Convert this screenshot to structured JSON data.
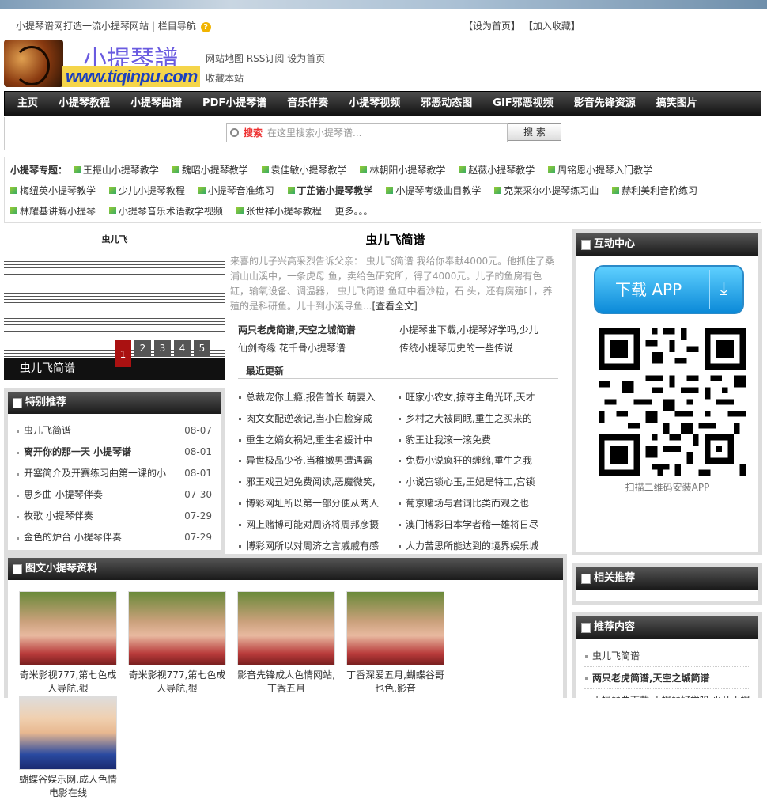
{
  "topbar": {
    "left": "小提琴谱网打造一流小提琴网站",
    "sep": "栏目导航",
    "home": "【设为首页】",
    "fav": "【加入收藏】"
  },
  "logo": {
    "cn": "小提琴譜",
    "url": "www.tiqinpu.com"
  },
  "sitelinks": {
    "map": "网站地图",
    "rss": "RSS订阅",
    "home": "设为首页",
    "collect": "收藏本站"
  },
  "nav": [
    "主页",
    "小提琴教程",
    "小提琴曲谱",
    "PDF小提琴谱",
    "音乐伴奏",
    "小提琴视频",
    "邪恶动态图",
    "GIF邪恶视频",
    "影音先锋资源",
    "搞笑图片"
  ],
  "search": {
    "label": "搜索",
    "placeholder": "在这里搜索小提琴谱...",
    "button": "搜 索"
  },
  "topics": {
    "label": "小提琴专题：",
    "items": [
      "王振山小提琴教学",
      "魏昭小提琴教学",
      "袁佳敏小提琴教学",
      "林朝阳小提琴教学",
      "赵薇小提琴教学",
      "周铭恩小提琴入门教学",
      "梅纽英小提琴教学",
      "少儿小提琴教程",
      "小提琴音准练习",
      "丁芷诺小提琴教学",
      "小提琴考级曲目教学",
      "克莱采尔小提琴练习曲",
      "赫利美利音阶练习",
      "林耀基讲解小提琴",
      "小提琴音乐术语教学视频",
      "张世祥小提琴教程"
    ],
    "more": "更多。。。"
  },
  "slide": {
    "caption": "虫儿飞简谱",
    "sheet_title": "虫儿飞",
    "pages": [
      "1",
      "2",
      "3",
      "4",
      "5"
    ]
  },
  "article": {
    "title": "虫儿飞简谱",
    "summary": "来喜的儿子兴高采烈告诉父亲： 虫儿飞简谱 我给你奉献4000元。他抓住了桑浦山山溪中，一条虎母 鱼，卖给色研究所，得了4000元。儿子的鱼房有色缸，输氧设备、调温器， 虫儿飞简谱 鱼缸中看沙粒，石 头，还有腐殖叶，养殖的是科研鱼。儿十到小溪寻鱼...",
    "more": "[查看全文]"
  },
  "links2": [
    "两只老虎简谱,天空之城简谱",
    "小提琴曲下载,小提琴好学吗,少儿",
    "仙剑奇缘 花千骨小提琴谱",
    "传统小提琴历史的一些传说"
  ],
  "recent": {
    "title": "最近更新",
    "items": [
      "总裁宠你上瘾,报告首长 萌妻入",
      "旺家小农女,掠夺主角光环,天才",
      "肉文女配逆袭记,当小白脸穿成",
      "乡村之大被同眠,重生之买来的",
      "重生之嫡女祸妃,重生名媛计中",
      "豹王让我滚一滚免费",
      "异世极品少爷,当稚嫩男遭遇霸",
      "免费小说疯狂的缠绵,重生之我",
      "邪王戏丑妃免费阅读,恶魔微笑,",
      "小说宫锁心玉,王妃是特工,宫锁",
      "博彩网址所以第一部分便从两人",
      "葡京赌场与君词比类而观之也",
      "网上赌博可能对周济将周邦彦摄",
      "澳门博彩日本学者稽一雄将日尽",
      "博彩网所以对周济之言戚戚有感",
      "人力苦思所能达到的境界娱乐城"
    ]
  },
  "special": {
    "title": "特别推荐",
    "items": [
      {
        "t": "虫儿飞简谱",
        "d": "08-07"
      },
      {
        "t": "离开你的那一天 小提琴谱",
        "d": "08-01",
        "bold": true
      },
      {
        "t": "开塞简介及开赛练习曲第一课的小",
        "d": "08-01"
      },
      {
        "t": "思乡曲 小提琴伴奏",
        "d": "07-30"
      },
      {
        "t": "牧歌 小提琴伴奏",
        "d": "07-29"
      },
      {
        "t": "金色的炉台 小提琴伴奏",
        "d": "07-29"
      }
    ]
  },
  "tuwen": {
    "title": "图文小提琴资料",
    "items": [
      "奇米影视777,第七色成人导航,狠",
      "奇米影视777,第七色成人导航,狠",
      "影音先锋成人色情网站,丁香五月",
      "丁香深爱五月,蝴蝶谷哥也色,影音",
      "蝴蝶谷娱乐网,成人色情电影在线"
    ]
  },
  "hudong": {
    "title": "互动中心",
    "app_label": "下载 APP",
    "qr_caption": "扫描二维码安装APP"
  },
  "xiangguan": {
    "title": "相关推荐"
  },
  "tuijian": {
    "title": "推荐内容",
    "items": [
      "虫儿飞简谱",
      "两只老虎简谱,天空之城简谱",
      "小提琴曲下载,小提琴好学吗,少儿小提"
    ]
  }
}
